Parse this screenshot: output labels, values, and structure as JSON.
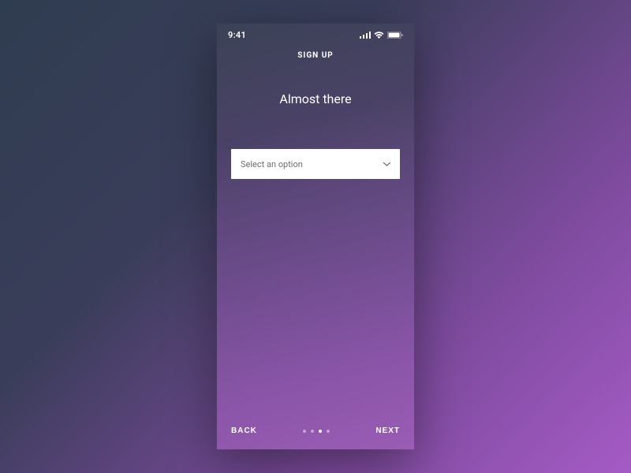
{
  "status_bar": {
    "time": "9:41"
  },
  "header": {
    "title": "SIGN UP"
  },
  "main": {
    "heading": "Almost there",
    "select": {
      "placeholder": "Select an option"
    }
  },
  "footer": {
    "back_label": "BACK",
    "next_label": "NEXT",
    "pagination": {
      "total": 4,
      "active_index": 2
    }
  }
}
